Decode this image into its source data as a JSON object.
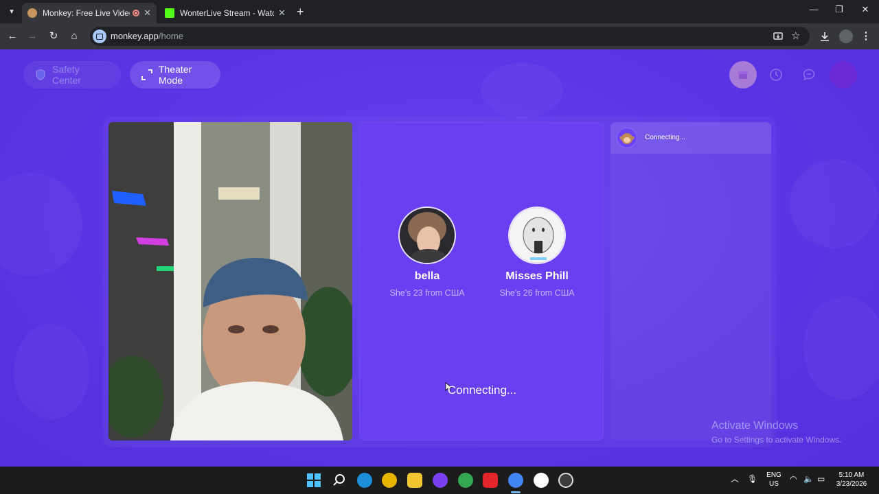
{
  "browser": {
    "tabs": [
      {
        "title": "Monkey: Free Live Video Ch",
        "active": true
      },
      {
        "title": "WonterLive Stream - Watch Live",
        "active": false
      }
    ],
    "url_domain": "monkey.app",
    "url_path": "/home"
  },
  "header": {
    "safety_label": "Safety Center",
    "theater_label": "Theater Mode"
  },
  "matches": [
    {
      "name": "bella",
      "info": "She's 23 from США"
    },
    {
      "name": "Misses Phill",
      "info": "She's 26 from США"
    }
  ],
  "main": {
    "status": "Connecting..."
  },
  "chat": {
    "status": "Connecting..."
  },
  "watermark": {
    "line1": "Activate Windows",
    "line2": "Go to Settings to activate Windows."
  },
  "taskbar": {
    "lang_line1": "ENG",
    "lang_line2": "US",
    "time": "5:10 AM",
    "date": "3/23/2026"
  },
  "colors": {
    "page_bg": "#5b34e6",
    "panel": "#6a3ff2",
    "chrome_dark": "#202124"
  }
}
